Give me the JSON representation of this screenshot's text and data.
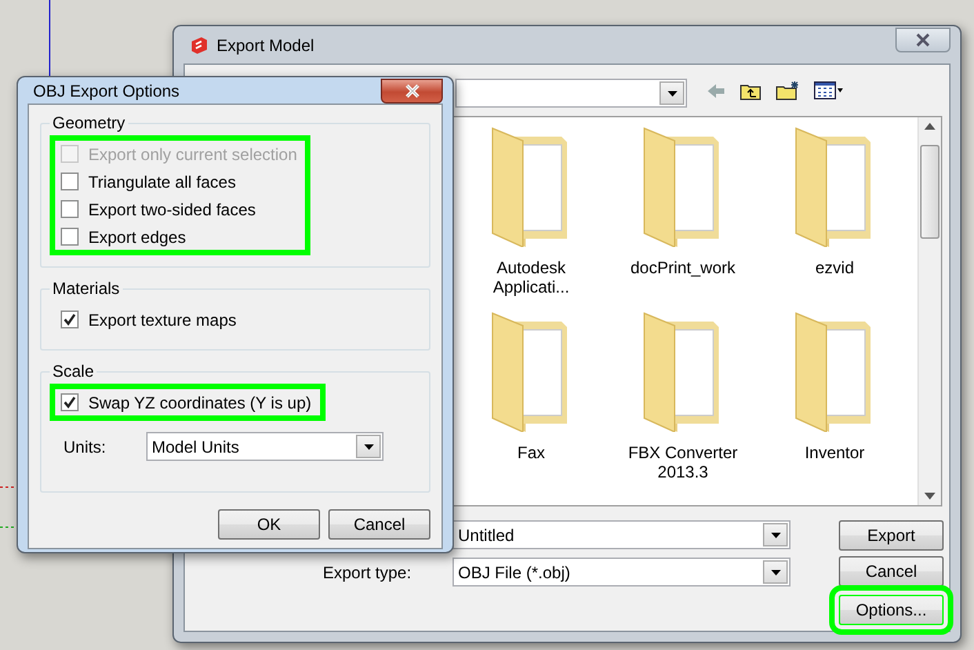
{
  "export_dialog": {
    "title": "Export Model",
    "file_items": [
      {
        "name": "Autodesk Applicati..."
      },
      {
        "name": "docPrint_work"
      },
      {
        "name": "ezvid"
      },
      {
        "name": "Fax"
      },
      {
        "name": "FBX Converter 2013.3"
      },
      {
        "name": "Inventor"
      }
    ],
    "file_name": {
      "value": "Untitled"
    },
    "export_type": {
      "label": "Export type:",
      "value": "OBJ File (*.obj)"
    },
    "buttons": [
      {
        "label": "Export",
        "highlighted": false
      },
      {
        "label": "Cancel",
        "highlighted": false
      },
      {
        "label": "Options...",
        "highlighted": true
      }
    ]
  },
  "options_dialog": {
    "title": "OBJ Export Options",
    "groups": [
      {
        "title": "Geometry",
        "highlighted": true,
        "options": [
          {
            "label": "Export only current selection",
            "checked": false,
            "disabled": true
          },
          {
            "label": "Triangulate all faces",
            "checked": false,
            "disabled": false
          },
          {
            "label": "Export two-sided faces",
            "checked": false,
            "disabled": false
          },
          {
            "label": "Export edges",
            "checked": false,
            "disabled": false
          }
        ]
      },
      {
        "title": "Materials",
        "highlighted": false,
        "options": [
          {
            "label": "Export texture maps",
            "checked": true,
            "disabled": false
          }
        ]
      },
      {
        "title": "Scale",
        "highlighted": true,
        "options": [
          {
            "label": "Swap YZ coordinates (Y is up)",
            "checked": true,
            "disabled": false
          }
        ],
        "units": {
          "label": "Units:",
          "value": "Model Units"
        }
      }
    ],
    "buttons": [
      {
        "label": "OK"
      },
      {
        "label": "Cancel"
      }
    ]
  }
}
